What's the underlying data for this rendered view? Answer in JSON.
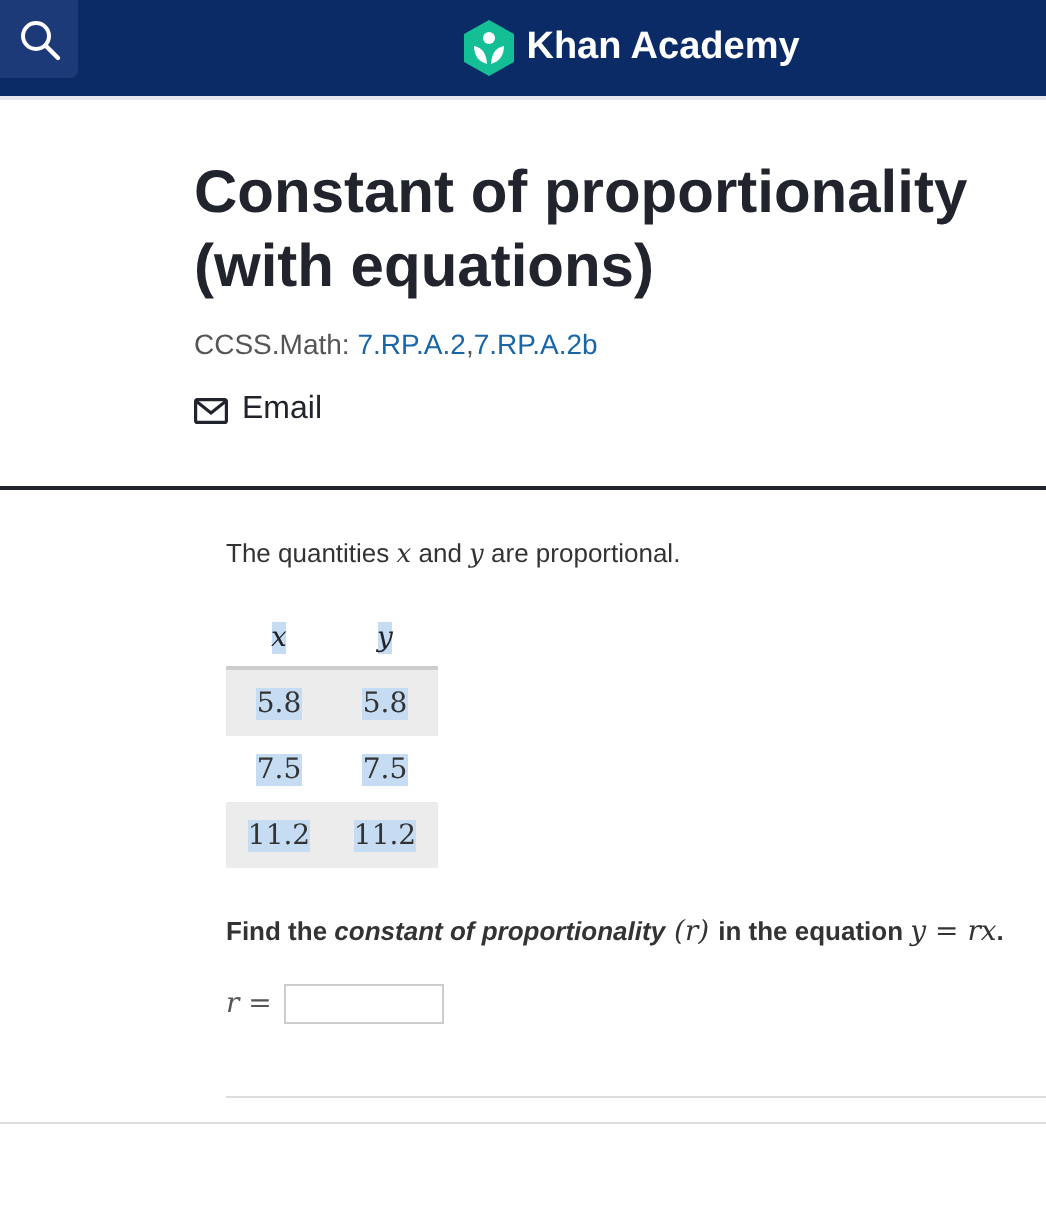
{
  "header": {
    "brand": "Khan Academy"
  },
  "title": "Constant of proportionality (with equations)",
  "standards": {
    "label": "CCSS.Math:",
    "links": [
      "7.RP.A.2",
      "7.RP.A.2b"
    ],
    "separator": ","
  },
  "share": {
    "label": "Email"
  },
  "problem": {
    "intro": [
      {
        "kind": "text",
        "text": "The quantities "
      },
      {
        "kind": "math",
        "text": "x"
      },
      {
        "kind": "text",
        "text": " and "
      },
      {
        "kind": "math",
        "text": "y"
      },
      {
        "kind": "text",
        "text": " are proportional."
      }
    ],
    "table": {
      "highlighted": true,
      "columns": [
        "x",
        "y"
      ],
      "rows": [
        [
          "5.8",
          "5.8"
        ],
        [
          "7.5",
          "7.5"
        ],
        [
          "11.2",
          "11.2"
        ]
      ]
    },
    "question": [
      {
        "kind": "text",
        "text": "Find the "
      },
      {
        "kind": "emph",
        "text": "constant of proportionality"
      },
      {
        "kind": "math",
        "text": " (r) "
      },
      {
        "kind": "text",
        "text": "in the equation "
      },
      {
        "kind": "math",
        "text": "y = rx"
      },
      {
        "kind": "text",
        "text": "."
      }
    ],
    "answer": {
      "label": "r ="
    }
  }
}
